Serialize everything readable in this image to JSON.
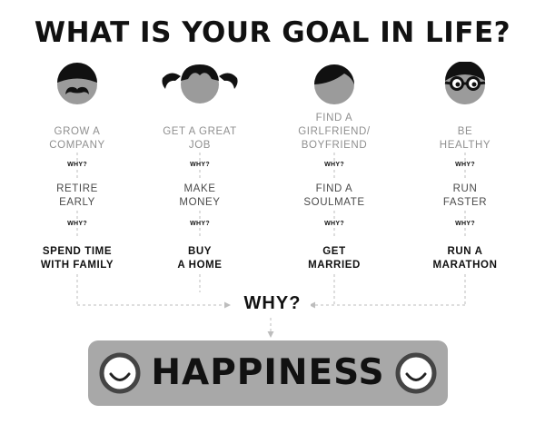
{
  "title": "WHAT IS YOUR GOAL IN LIFE?",
  "small_why": "WHY?",
  "big_why": "WHY?",
  "happiness": "HAPPINESS",
  "columns": [
    {
      "avatar": "man-with-mustache-icon",
      "goal": [
        "GROW A",
        "COMPANY"
      ],
      "reason": [
        "RETIRE",
        "EARLY"
      ],
      "final": [
        "SPEND TIME",
        "WITH FAMILY"
      ]
    },
    {
      "avatar": "girl-with-pigtails-icon",
      "goal": [
        "GET A GREAT",
        "JOB"
      ],
      "reason": [
        "MAKE",
        "MONEY"
      ],
      "final": [
        "BUY",
        "A HOME"
      ]
    },
    {
      "avatar": "person-with-side-part-icon",
      "goal": [
        "FIND A",
        "GIRLFRIEND/",
        "BOYFRIEND"
      ],
      "reason": [
        "FIND A",
        "SOULMATE"
      ],
      "final": [
        "GET",
        "MARRIED"
      ]
    },
    {
      "avatar": "person-with-glasses-icon",
      "goal": [
        "BE",
        "HEALTHY"
      ],
      "reason": [
        "RUN",
        "FASTER"
      ],
      "final": [
        "RUN A",
        "MARATHON"
      ]
    }
  ],
  "colors": {
    "title": "#111111",
    "avatar_face": "#9b9b9b",
    "avatar_hair": "#111111",
    "goal_text": "#8f8f8f",
    "connector": "#bdbdbd",
    "happiness_box": "#a8a8a8",
    "smiley": "#444444"
  }
}
